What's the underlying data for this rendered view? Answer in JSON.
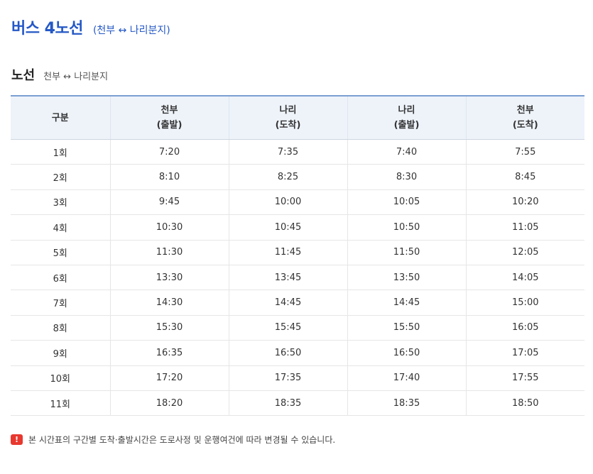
{
  "header": {
    "title": "버스 4노선",
    "subtitle": "(천부 ↔ 나리분지)"
  },
  "section": {
    "title": "노선",
    "route": "천부 ↔ 나리분지"
  },
  "table": {
    "headers": [
      [
        "구분"
      ],
      [
        "천부",
        "(출발)"
      ],
      [
        "나리",
        "(도착)"
      ],
      [
        "나리",
        "(출발)"
      ],
      [
        "천부",
        "(도착)"
      ]
    ],
    "rows": [
      [
        "1회",
        "7:20",
        "7:35",
        "7:40",
        "7:55"
      ],
      [
        "2회",
        "8:10",
        "8:25",
        "8:30",
        "8:45"
      ],
      [
        "3회",
        "9:45",
        "10:00",
        "10:05",
        "10:20"
      ],
      [
        "4회",
        "10:30",
        "10:45",
        "10:50",
        "11:05"
      ],
      [
        "5회",
        "11:30",
        "11:45",
        "11:50",
        "12:05"
      ],
      [
        "6회",
        "13:30",
        "13:45",
        "13:50",
        "14:05"
      ],
      [
        "7회",
        "14:30",
        "14:45",
        "14:45",
        "15:00"
      ],
      [
        "8회",
        "15:30",
        "15:45",
        "15:50",
        "16:05"
      ],
      [
        "9회",
        "16:35",
        "16:50",
        "16:50",
        "17:05"
      ],
      [
        "10회",
        "17:20",
        "17:35",
        "17:40",
        "17:55"
      ],
      [
        "11회",
        "18:20",
        "18:35",
        "18:35",
        "18:50"
      ]
    ]
  },
  "notice": {
    "icon": "exclamation-icon",
    "icon_glyph": "!",
    "icon_color": "#e8382f",
    "text": "본 시간표의 구간별 도착·출발시간은 도로사정 및 운행여건에 따라 변경될 수 있습니다."
  },
  "colors": {
    "accent": "#2458c6",
    "header_bg": "#eef3fa",
    "table_top_border": "#7a9fd3"
  }
}
